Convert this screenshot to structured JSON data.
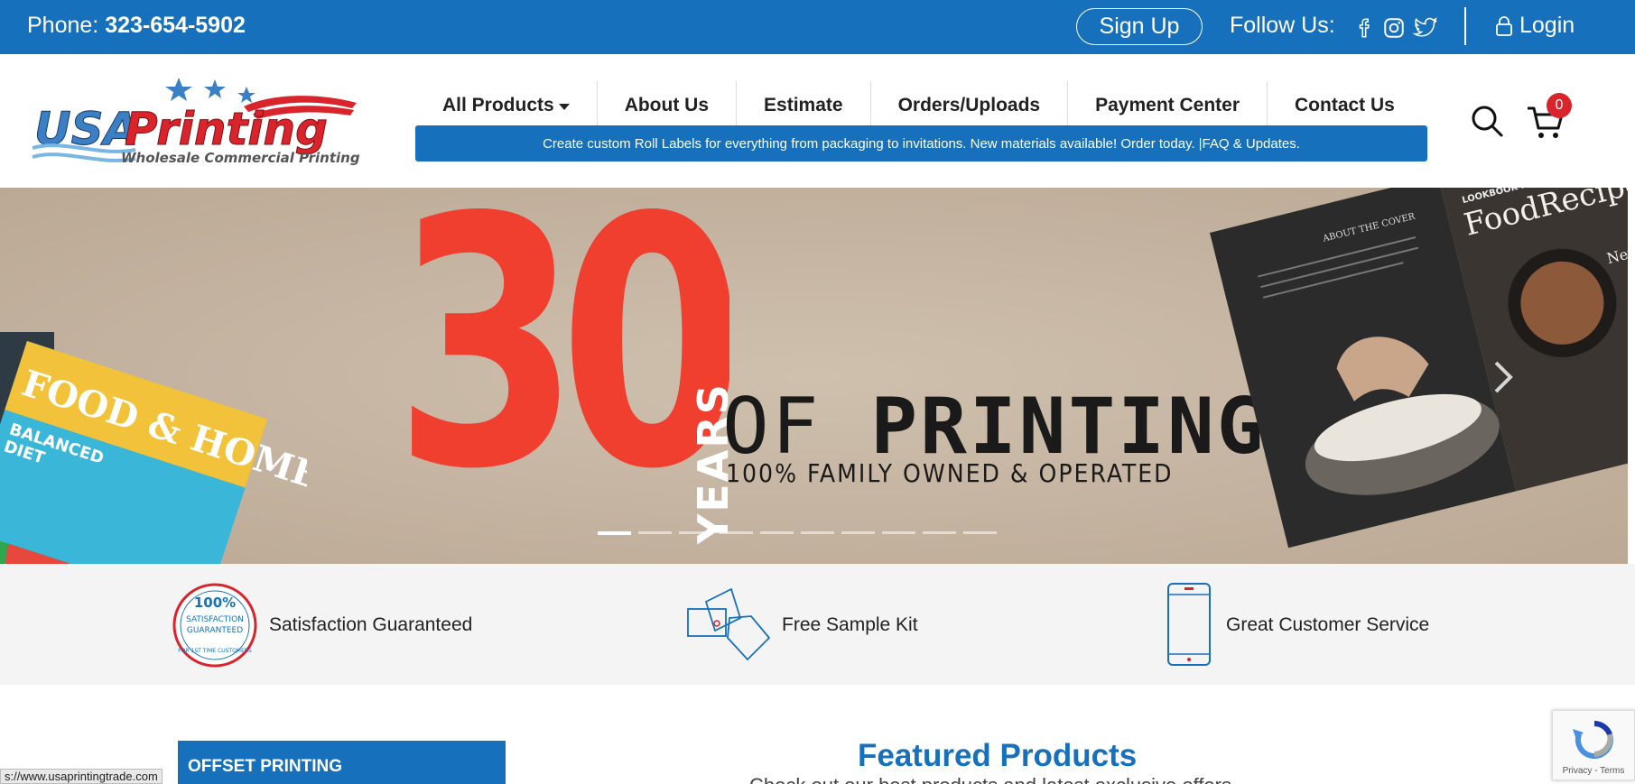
{
  "topbar": {
    "phone_label": "Phone:",
    "phone_number": "323-654-5902",
    "signup_label": "Sign Up",
    "follow_label": "Follow Us:",
    "social_icons": [
      "facebook-icon",
      "instagram-icon",
      "twitter-icon"
    ],
    "login_label": "Login"
  },
  "logo": {
    "brand_part1": "USA",
    "brand_part2": "Printing",
    "tagline": "Wholesale Commercial Printing"
  },
  "nav": {
    "items": [
      {
        "label": "All Products",
        "has_dropdown": true
      },
      {
        "label": "About Us"
      },
      {
        "label": "Estimate"
      },
      {
        "label": "Orders/Uploads"
      },
      {
        "label": "Payment Center"
      },
      {
        "label": "Contact Us"
      }
    ]
  },
  "announcement": {
    "text": "Create custom Roll Labels for everything from packaging to invitations. New materials available! Order today.",
    "separator": " |",
    "link_label": "FAQ & Updates."
  },
  "cart": {
    "count": "0"
  },
  "hero": {
    "big_number": "30",
    "years_label": "YEARS",
    "of_label": "OF",
    "printing_label": "PRINTING!",
    "subline": "100% FAMILY OWNED & OPERATED",
    "left_magazine_title": "FOOD & HOME",
    "left_magazine_sub1": "BALANCED",
    "left_magazine_sub2": "DIET",
    "left_magazine_edge": "pe",
    "right_magazine_title": "FoodRecipe",
    "right_magazine_sub": "LOOKBOOK MAGAZINE",
    "right_magazine_heading": "ABOUT THE COVER",
    "right_magazine_page": "New Rec",
    "slides_total": 10,
    "active_slide": 1
  },
  "features": [
    {
      "icon": "satisfaction-guarantee-icon",
      "label": "Satisfaction Guaranteed",
      "badge_top": "100%",
      "badge_mid1": "SATISFACTION",
      "badge_mid2": "GUARANTEED",
      "badge_bottom": "FOR 1ST TIME CUSTOMERS"
    },
    {
      "icon": "sample-kit-icon",
      "label": "Free Sample Kit"
    },
    {
      "icon": "mobile-phone-icon",
      "label": "Great Customer Service"
    }
  ],
  "sidebar": {
    "first_category": "OFFSET PRINTING"
  },
  "featured": {
    "title": "Featured Products",
    "subtitle": "Check out our best products and latest exclusive offers"
  },
  "status_bar": {
    "url": "s://www.usaprintingtrade.com"
  },
  "recaptcha": {
    "links": "Privacy - Terms"
  },
  "colors": {
    "brand_blue": "#1670bb",
    "accent_red": "#f03e2f",
    "badge_red": "#d9242b"
  }
}
